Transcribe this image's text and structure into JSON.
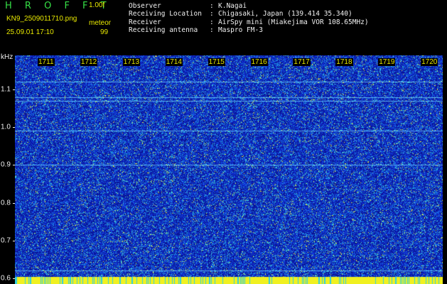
{
  "header": {
    "app_title": "H R O F F T",
    "version": "1.00f",
    "filename": "KN9_2509011710.png",
    "datetime": "25.09.01 17:10",
    "meteor_label": "meteor",
    "meteor_count": "99"
  },
  "info": {
    "rows": [
      {
        "key": "Observer",
        "sep": ":",
        "value": "K.Nagai"
      },
      {
        "key": "Receiving Location",
        "sep": ":",
        "value": "Chigasaki, Japan (139.414 35.340)"
      },
      {
        "key": "Receiver",
        "sep": ":",
        "value": "AirSpy mini (Miakejima VOR 108.65MHz)"
      },
      {
        "key": "Receiving antenna",
        "sep": ":",
        "value": "Maspro FM-3"
      }
    ]
  },
  "chart_data": {
    "type": "heatmap",
    "ylabel": "kHz",
    "y_ticks": [
      "1.1",
      "1.0",
      "0.9",
      "0.8",
      "0.7",
      "0.6"
    ],
    "y_tick_values": [
      1.1,
      1.0,
      0.9,
      0.8,
      0.7,
      0.6
    ],
    "ylim": [
      0.585,
      1.19
    ],
    "time_labels": [
      "1711",
      "1712",
      "1713",
      "1714",
      "1715",
      "1716",
      "1717",
      "1718",
      "1719",
      "1720"
    ],
    "steady_lines_khz": [
      1.12,
      1.08,
      1.07,
      0.99,
      0.9,
      0.62,
      0.6
    ],
    "colors": {
      "background": "#0a1aa0",
      "noise_low": "#1030d0",
      "noise_mid": "#20a0e0",
      "noise_high": "#e0f040",
      "baseline": "#f0f020",
      "carrier": "#70d8ff"
    }
  }
}
